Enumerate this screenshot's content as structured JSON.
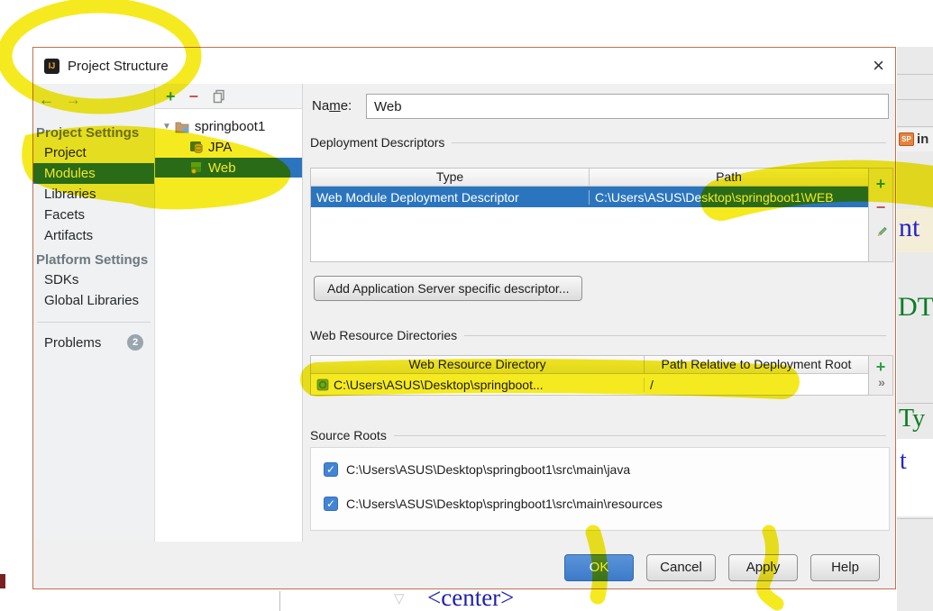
{
  "window": {
    "title": "Project Structure",
    "close_glyph": "×",
    "logo_text": "IJ"
  },
  "background": {
    "jsp_badge": "SP",
    "frag_in": "in",
    "frag_nt": "nt",
    "frag_dt": "DT",
    "frag_ty": "Ty",
    "frag_t": "t",
    "frag_center": "<center>",
    "fold_glyph": "▽"
  },
  "icons": {
    "back": "←",
    "forward": "→",
    "plus": "+",
    "minus": "−",
    "expand": "▼",
    "chevrons": "»",
    "check": "✓"
  },
  "sidebar": {
    "sections": [
      {
        "header": "Project Settings",
        "items": [
          {
            "label": "Project"
          },
          {
            "label": "Modules",
            "selected": true
          },
          {
            "label": "Libraries"
          },
          {
            "label": "Facets"
          },
          {
            "label": "Artifacts"
          }
        ]
      },
      {
        "header": "Platform Settings",
        "items": [
          {
            "label": "SDKs"
          },
          {
            "label": "Global Libraries"
          }
        ]
      }
    ],
    "problems": {
      "label": "Problems",
      "badge": "2"
    }
  },
  "tree": {
    "root": "springboot1",
    "children": [
      {
        "label": "JPA"
      },
      {
        "label": "Web",
        "selected": true
      }
    ]
  },
  "form": {
    "name_label_pre": "Na",
    "name_label_mnemonic": "m",
    "name_label_post": "e:",
    "name_value": "Web",
    "deployment": {
      "title": "Deployment Descriptors",
      "columns": [
        "Type",
        "Path"
      ],
      "rows": [
        {
          "type": "Web Module Deployment Descriptor",
          "path": "C:\\Users\\ASUS\\Desktop\\springboot1\\WEB"
        }
      ]
    },
    "add_descriptor_button": "Add Application Server specific descriptor...",
    "web_resources": {
      "title": "Web Resource Directories",
      "columns": [
        "Web Resource Directory",
        "Path Relative to Deployment Root"
      ],
      "rows": [
        {
          "directory": "C:\\Users\\ASUS\\Desktop\\springboot...",
          "relative": "/"
        }
      ]
    },
    "source_roots": {
      "title": "Source Roots",
      "items": [
        {
          "path": "C:\\Users\\ASUS\\Desktop\\springboot1\\src\\main\\java",
          "checked": true
        },
        {
          "path": "C:\\Users\\ASUS\\Desktop\\springboot1\\src\\main\\resources",
          "checked": true
        }
      ]
    }
  },
  "footer": {
    "ok": "OK",
    "cancel": "Cancel",
    "apply": "Apply",
    "help": "Help"
  },
  "colors": {
    "selection_blue": "#2b75bf",
    "ok_blue": "#4285d4",
    "marker_yellow": "#f5e90f",
    "dialog_border": "#c0714f",
    "add_green": "#2f9e44",
    "remove_red": "#c75450"
  }
}
